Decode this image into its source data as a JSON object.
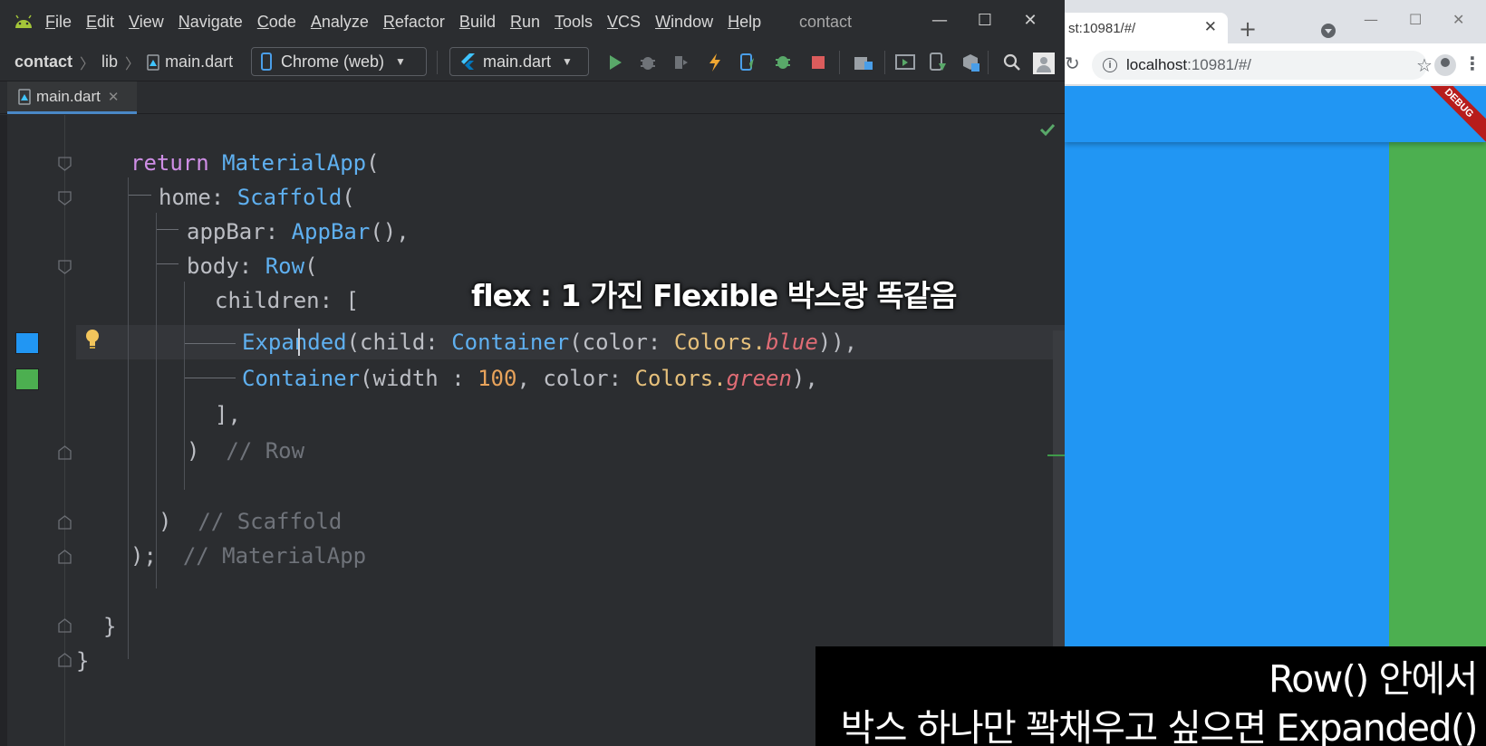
{
  "ide": {
    "menu": [
      "File",
      "Edit",
      "View",
      "Navigate",
      "Code",
      "Analyze",
      "Refactor",
      "Build",
      "Run",
      "Tools",
      "VCS",
      "Window",
      "Help"
    ],
    "window_title": "contact",
    "breadcrumb": [
      "contact",
      "lib",
      "main.dart"
    ],
    "device_selector": "Chrome (web)",
    "run_config": "main.dart",
    "tab": {
      "label": "main.dart"
    },
    "code": {
      "l1_kw": "return",
      "l1_cls": "MaterialApp",
      "l1_p": "(",
      "l2_prm": "home:",
      "l2_cls": "Scaffold",
      "l2_p": "(",
      "l3_prm": "appBar:",
      "l3_cls": "AppBar",
      "l3_p": "(),",
      "l4_prm": "body:",
      "l4_cls": "Row",
      "l4_p": "(",
      "l5_prm": "children:",
      "l5_p": "[",
      "l6_cls1": "Expanded",
      "l6_p1": "(child: ",
      "l6_cls2": "Container",
      "l6_p2": "(color: ",
      "l6_yel": "Colors.",
      "l6_ital": "blue",
      "l6_p3": ")),",
      "l7_cls": "Container",
      "l7_p1": "(width ",
      "l7_colon": ":",
      "l7_num": "100",
      "l7_p2": ", color: ",
      "l7_yel": "Colors.",
      "l7_ital": "green",
      "l7_p3": "),",
      "l8": "],",
      "l9_p": ")",
      "l9_cm": "// Row",
      "l10_p": ")",
      "l10_cm": "// Scaffold",
      "l11_p": ");",
      "l11_cm": "// MaterialApp",
      "l12": "}",
      "l13": "}"
    },
    "overlay_caption": "flex : 1 가진 Flexible 박스랑 똑같음"
  },
  "browser": {
    "tab_title": "st:10981/#/",
    "url_host": "localhost",
    "url_rest": ":10981/#/",
    "debug_banner": "DEBUG"
  },
  "subtitle": {
    "line1": "Row() 안에서",
    "line2": "박스 하나만 꽉채우고 싶으면 Expanded()"
  },
  "colors": {
    "flutter_blue": "#2196f3",
    "flutter_green": "#4caf50",
    "ide_bg": "#2b2d30",
    "keyword": "#cf8ee6",
    "class": "#5fb0f0"
  },
  "icons": [
    "android-icon",
    "phone-icon",
    "flutter-icon",
    "run-icon",
    "debug-icon",
    "hot-reload-icon",
    "stop-icon",
    "search-icon",
    "user-icon",
    "lightbulb-icon",
    "check-icon",
    "fold-icon"
  ]
}
